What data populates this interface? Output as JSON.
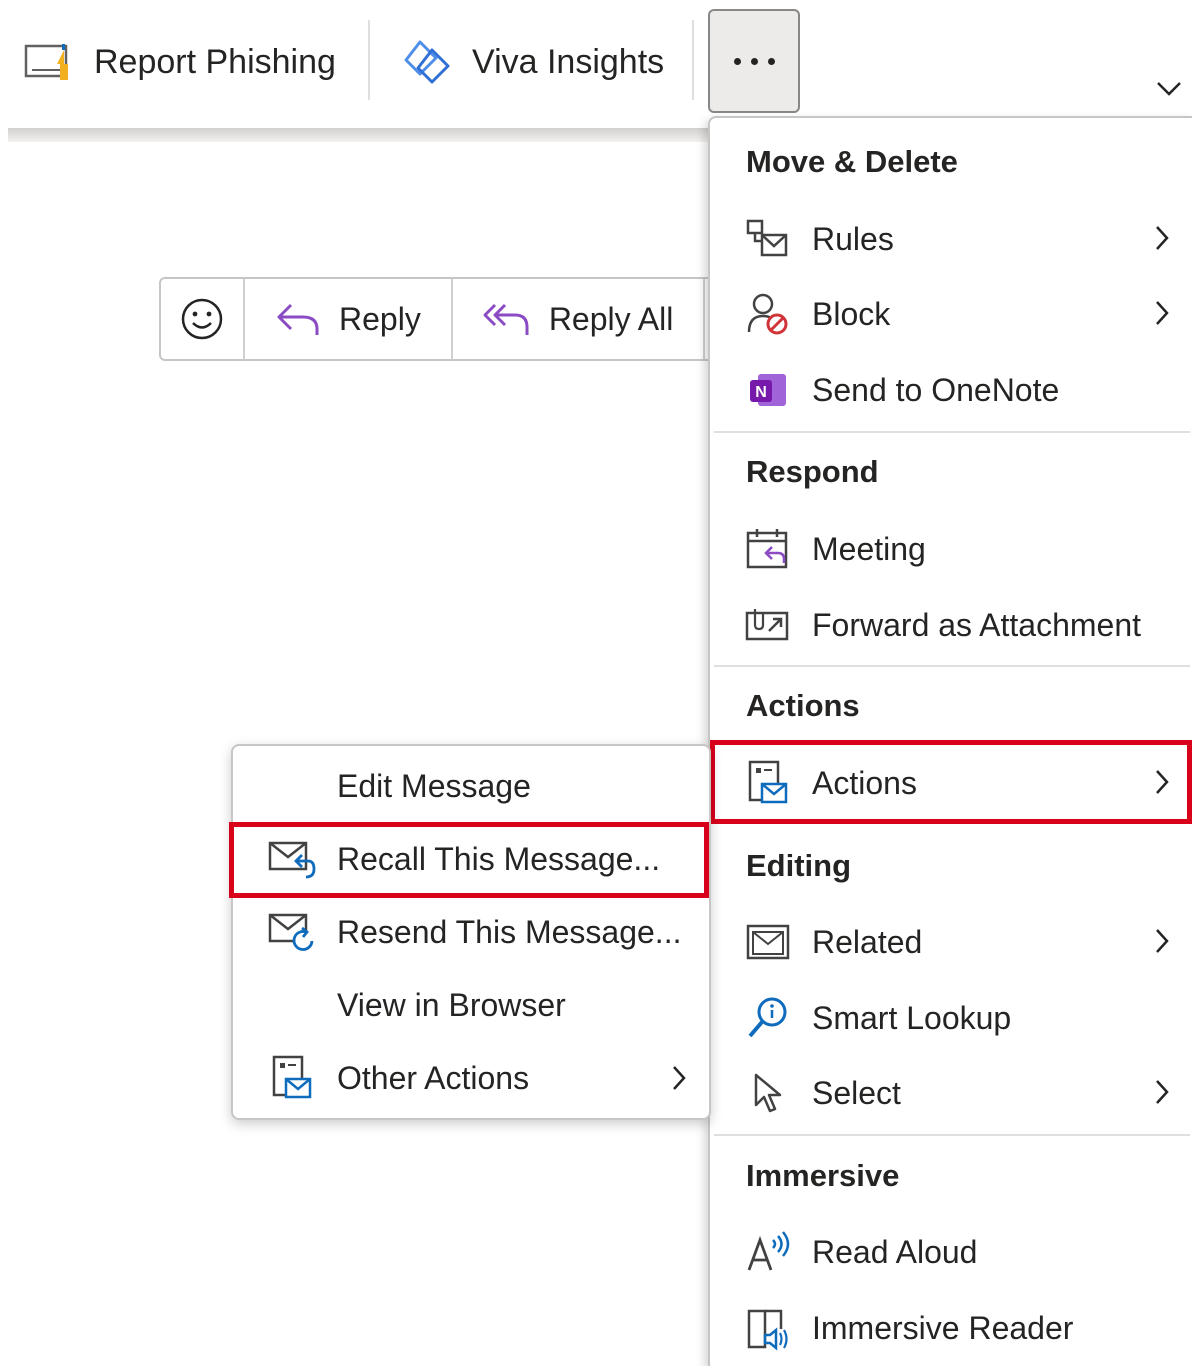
{
  "ribbon": {
    "report_phishing": "Report Phishing",
    "viva_insights": "Viva Insights",
    "more_label": "More options"
  },
  "reply_bar": {
    "reply": "Reply",
    "reply_all": "Reply All"
  },
  "menu": {
    "sections": {
      "move_delete": "Move & Delete",
      "respond": "Respond",
      "actions": "Actions",
      "editing": "Editing",
      "immersive": "Immersive"
    },
    "items": {
      "rules": "Rules",
      "block": "Block",
      "send_onenote": "Send to OneNote",
      "meeting": "Meeting",
      "forward_attachment": "Forward as Attachment",
      "actions": "Actions",
      "related": "Related",
      "smart_lookup": "Smart Lookup",
      "select": "Select",
      "read_aloud": "Read Aloud",
      "immersive_reader": "Immersive Reader"
    }
  },
  "submenu": {
    "edit_message": "Edit Message",
    "recall_message": "Recall This Message...",
    "resend_message": "Resend This Message...",
    "view_browser": "View in Browser",
    "other_actions": "Other Actions"
  },
  "colors": {
    "highlight": "#d9001b",
    "accent": "#0f6cbd",
    "onenote": "#7719aa"
  }
}
